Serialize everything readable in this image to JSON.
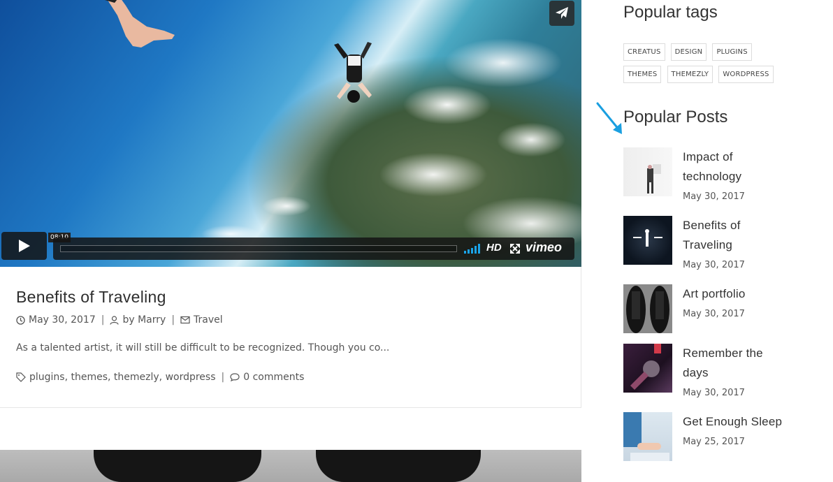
{
  "video": {
    "time": "08:10",
    "hd": "HD",
    "brand": "vimeo"
  },
  "post": {
    "title": "Benefits of Traveling",
    "date": "May 30, 2017",
    "author": "by Marry",
    "category": "Travel",
    "excerpt": "As a talented artist, it will still be difficult to be recognized. Though you co...",
    "tags": "plugins, themes, themezly, wordpress",
    "comments": "0 comments"
  },
  "sidebar": {
    "tags_title": "Popular tags",
    "tags": [
      "CREATUS",
      "DESIGN",
      "PLUGINS",
      "THEMES",
      "THEMEZLY",
      "WORDPRESS"
    ],
    "posts_title": "Popular Posts",
    "posts": [
      {
        "title": "Impact of technology",
        "date": "May 30, 2017"
      },
      {
        "title": "Benefits of Traveling",
        "date": "May 30, 2017"
      },
      {
        "title": "Art portfolio",
        "date": "May 30, 2017"
      },
      {
        "title": "Remember the days",
        "date": "May 30, 2017"
      },
      {
        "title": "Get Enough Sleep",
        "date": "May 25, 2017"
      }
    ]
  },
  "colors": {
    "arrow": "#1a9fe0",
    "title": "#2e2e2e",
    "meta": "#555555",
    "border": "#e6e6e6",
    "volume": "#1aa3e8"
  },
  "icons": {
    "share": "paper-plane-icon",
    "play": "play-icon",
    "volume": "volume-icon",
    "fullscreen": "fullscreen-icon",
    "date": "clock-icon",
    "author": "user-icon",
    "category": "folder-icon",
    "tags": "tag-icon",
    "comments": "comment-icon"
  }
}
